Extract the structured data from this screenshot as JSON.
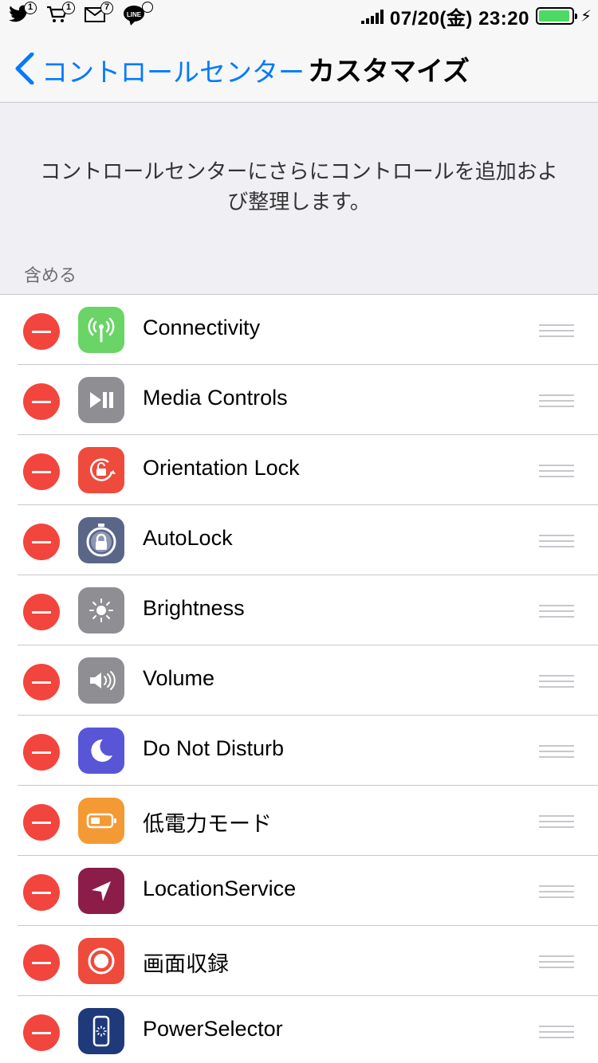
{
  "status_bar": {
    "notifications": [
      {
        "icon": "twitter-icon",
        "badge": "1"
      },
      {
        "icon": "shopping-cart-icon",
        "badge": "1"
      },
      {
        "icon": "mail-icon",
        "badge": "7"
      },
      {
        "icon": "line-icon",
        "badge": ""
      }
    ],
    "datetime": "07/20(金) 23:20",
    "battery_level": 0.95,
    "charging_icon": "⚡"
  },
  "nav": {
    "back_label": "コントロールセンター",
    "title": "カスタマイズ"
  },
  "description": "コントロールセンターにさらにコントロールを追加およ び整理します。",
  "section_header": "含める",
  "items": [
    {
      "label": "Connectivity",
      "icon": "antenna-icon",
      "color": "#6ad466"
    },
    {
      "label": "Media Controls",
      "icon": "play-pause-icon",
      "color": "#8e8e93"
    },
    {
      "label": "Orientation Lock",
      "icon": "rotation-lock-icon",
      "color": "#ee4b3d"
    },
    {
      "label": "AutoLock",
      "icon": "stopwatch-lock-icon",
      "color": "#5a6688"
    },
    {
      "label": "Brightness",
      "icon": "sun-icon",
      "color": "#8e8e93"
    },
    {
      "label": "Volume",
      "icon": "speaker-icon",
      "color": "#8e8e93"
    },
    {
      "label": "Do Not Disturb",
      "icon": "moon-icon",
      "color": "#5856d6"
    },
    {
      "label": "低電力モード",
      "icon": "battery-icon",
      "color": "#f49a34"
    },
    {
      "label": "LocationService",
      "icon": "location-arrow-icon",
      "color": "#8b1d48"
    },
    {
      "label": "画面収録",
      "icon": "record-icon",
      "color": "#ee4b3d"
    },
    {
      "label": "PowerSelector",
      "icon": "phone-spinner-icon",
      "color": "#1f3a7a"
    }
  ]
}
